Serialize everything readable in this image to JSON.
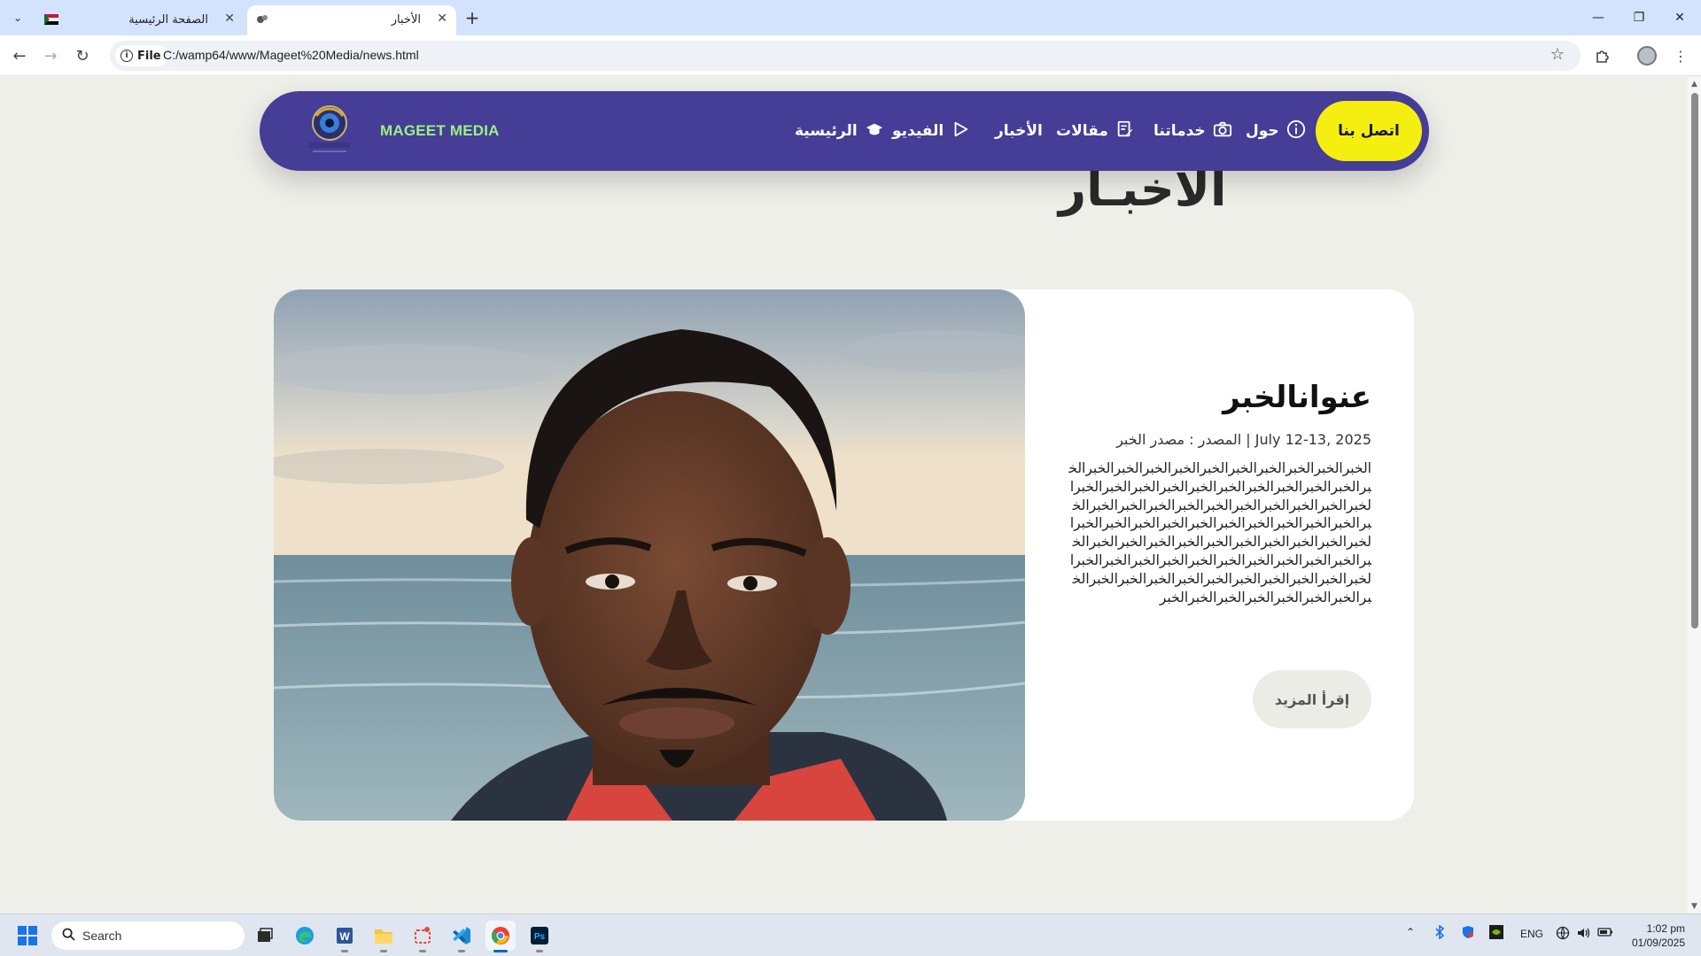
{
  "browser": {
    "tabs": [
      {
        "title": "الصفحة الرئيسية",
        "active": false
      },
      {
        "title": "الأخبار",
        "active": true
      }
    ],
    "new_tab_symbol": "+",
    "address": {
      "scheme_label": "File",
      "url": "C:/wamp64/www/Mageet%20Media/news.html"
    }
  },
  "site": {
    "brand": "MAGEET MEDIA",
    "nav": {
      "contact": "اتصل بنا",
      "items": [
        {
          "label": "حول",
          "icon": "info-icon"
        },
        {
          "label": "خدماتنا",
          "icon": "camera-icon"
        },
        {
          "label": "مقالات",
          "icon": "edit-icon"
        },
        {
          "label": "الأخبار",
          "icon": ""
        },
        {
          "label": "الفيديو",
          "icon": "play-icon"
        },
        {
          "label": "الرئيسية",
          "icon": "graduation-cap-icon"
        }
      ]
    },
    "page_heading": "الأخبـار",
    "news": {
      "title": "عنوانالخبر",
      "meta": "July 12-13, 2025 | المصدر : مصدر الخبر",
      "body": "الخبرالخبرالخبرالخبرالخبرالخبرالخبرالخبرالخبرالخبرالخبرالخبرالخبرالخبرالخبرالخبرالخبرالخبرالخبرالخبرالخبرالخبرالخبرالخبرالخبرالخبرالخبرالخبرالخبرالخبرالخبرالخبرالخبرالخبرالخبرالخبرالخبرالخبرالخبرالخبرالخبرالخبرالخبرالخبرالخبرالخبرالخبرالخبرالخبرالخبرالخبرالخبرالخبرالخبرالخبرالخبرالخبرالخبرالخبرالخبرالخبرالخبرالخبرالخبرالخبرالخبرالخبرالخبرالخبرالخبرالخبرالخبرالخبرالخبرالخبرالخبرالخبرالخبرالخبرالخبرالخبر",
      "read_more": "إقرأ المزيد"
    }
  },
  "taskbar": {
    "search_placeholder": "Search",
    "language": "ENG",
    "time": "1:02 pm",
    "date": "01/09/2025"
  },
  "colors": {
    "nav_bg": "#453d96",
    "brand_green": "#9cf27e",
    "contact_yellow": "#f4ef11",
    "page_bg": "#efefea",
    "chrome_tabbar": "#d3e3fd"
  }
}
